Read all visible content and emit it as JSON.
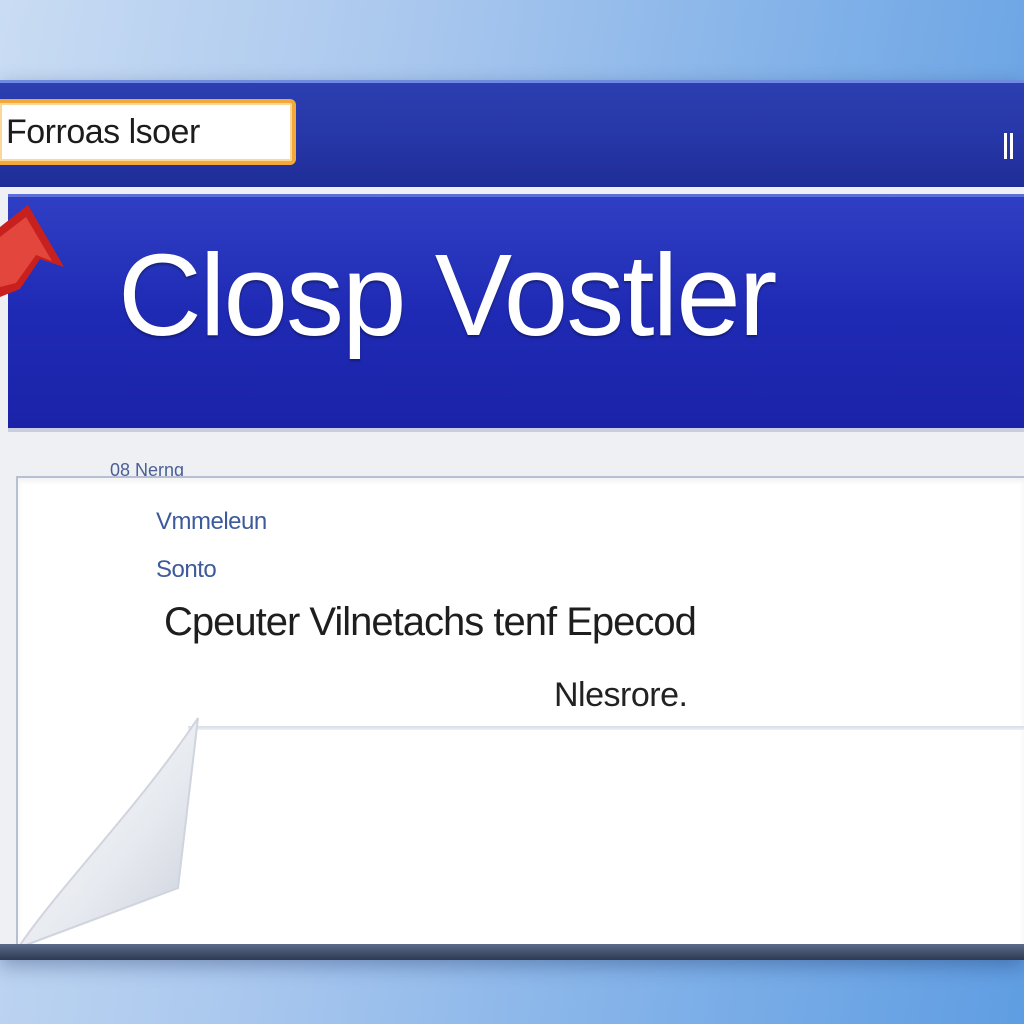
{
  "window": {
    "title_field": "Forroas lsoer"
  },
  "banner": {
    "title": "Closp Vostler"
  },
  "content": {
    "section_label": "08 Nerng",
    "link_1": "Vmmeleun",
    "link_2": "Sonto",
    "message": "Cpeuter Vilnetachs tenf Epecod",
    "action": "Nlesrore."
  },
  "colors": {
    "titlebar": "#2636a6",
    "banner": "#1f2ab4",
    "title_field_border": "#f3a93a",
    "link": "#3d5a9c",
    "arrow": "#c8201e"
  }
}
